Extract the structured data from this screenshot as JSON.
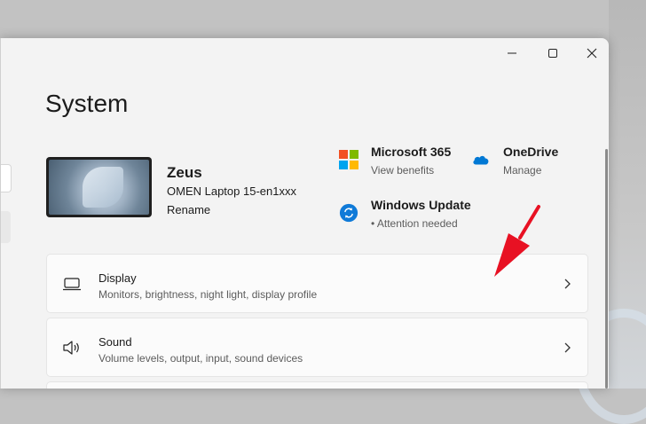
{
  "window": {
    "title": "System"
  },
  "device": {
    "name": "Zeus",
    "model": "OMEN Laptop 15-en1xxx",
    "rename_label": "Rename"
  },
  "quick_links": [
    {
      "title": "Microsoft 365",
      "subtitle": "View benefits",
      "icon": "microsoft-365-icon"
    },
    {
      "title": "OneDrive",
      "subtitle": "Manage",
      "icon": "onedrive-icon"
    },
    {
      "title": "Windows Update",
      "subtitle": "• Attention needed",
      "icon": "windows-update-icon"
    }
  ],
  "settings": [
    {
      "title": "Display",
      "subtitle": "Monitors, brightness, night light, display profile",
      "icon": "laptop-icon"
    },
    {
      "title": "Sound",
      "subtitle": "Volume levels, output, input, sound devices",
      "icon": "speaker-icon"
    }
  ],
  "colors": {
    "window_bg": "#f3f3f3",
    "card_bg": "#fbfbfb",
    "accent_blue": "#0067c0",
    "annotation_arrow": "#e81123",
    "ms_red": "#f25022",
    "ms_green": "#7fba00",
    "ms_blue": "#00a4ef",
    "ms_yellow": "#ffb900"
  }
}
